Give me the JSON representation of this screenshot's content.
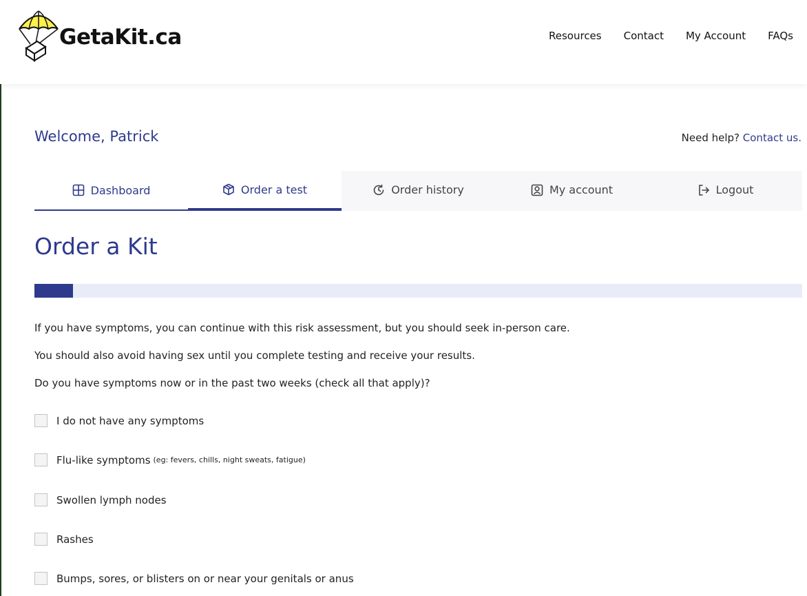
{
  "header": {
    "logo_text": "GetaKit.ca",
    "nav": [
      "Resources",
      "Contact",
      "My Account",
      "FAQs"
    ]
  },
  "welcome": "Welcome, Patrick",
  "help": {
    "text": "Need help?",
    "link": "Contact us."
  },
  "tabs": [
    {
      "label": "Dashboard",
      "icon": "grid-icon"
    },
    {
      "label": "Order a test",
      "icon": "box-icon"
    },
    {
      "label": "Order history",
      "icon": "history-icon"
    },
    {
      "label": "My account",
      "icon": "user-icon"
    },
    {
      "label": "Logout",
      "icon": "logout-icon"
    }
  ],
  "active_tab": "Order a test",
  "page_title": "Order a Kit",
  "progress": {
    "fraction": 0.05
  },
  "intro": [
    "If you have symptoms, you can continue with this risk assessment, but you should seek in-person care.",
    "You should also avoid having sex until you complete testing and receive your results.",
    "Do you have symptoms now or in the past two weeks (check all that apply)?"
  ],
  "options": [
    {
      "label": "I do not have any symptoms",
      "note": "",
      "checked": false
    },
    {
      "label": "Flu-like symptoms",
      "note": "(eg: fevers, chills, night sweats, fatigue)",
      "checked": false
    },
    {
      "label": "Swollen lymph nodes",
      "note": "",
      "checked": false
    },
    {
      "label": "Rashes",
      "note": "",
      "checked": false
    },
    {
      "label": "Bumps, sores, or blisters on or near your genitals or anus",
      "note": "",
      "checked": false
    }
  ],
  "colors": {
    "brand": "#2e3a8c",
    "progress_track": "#e9ecf8",
    "logo_chute": "#fff04d"
  }
}
